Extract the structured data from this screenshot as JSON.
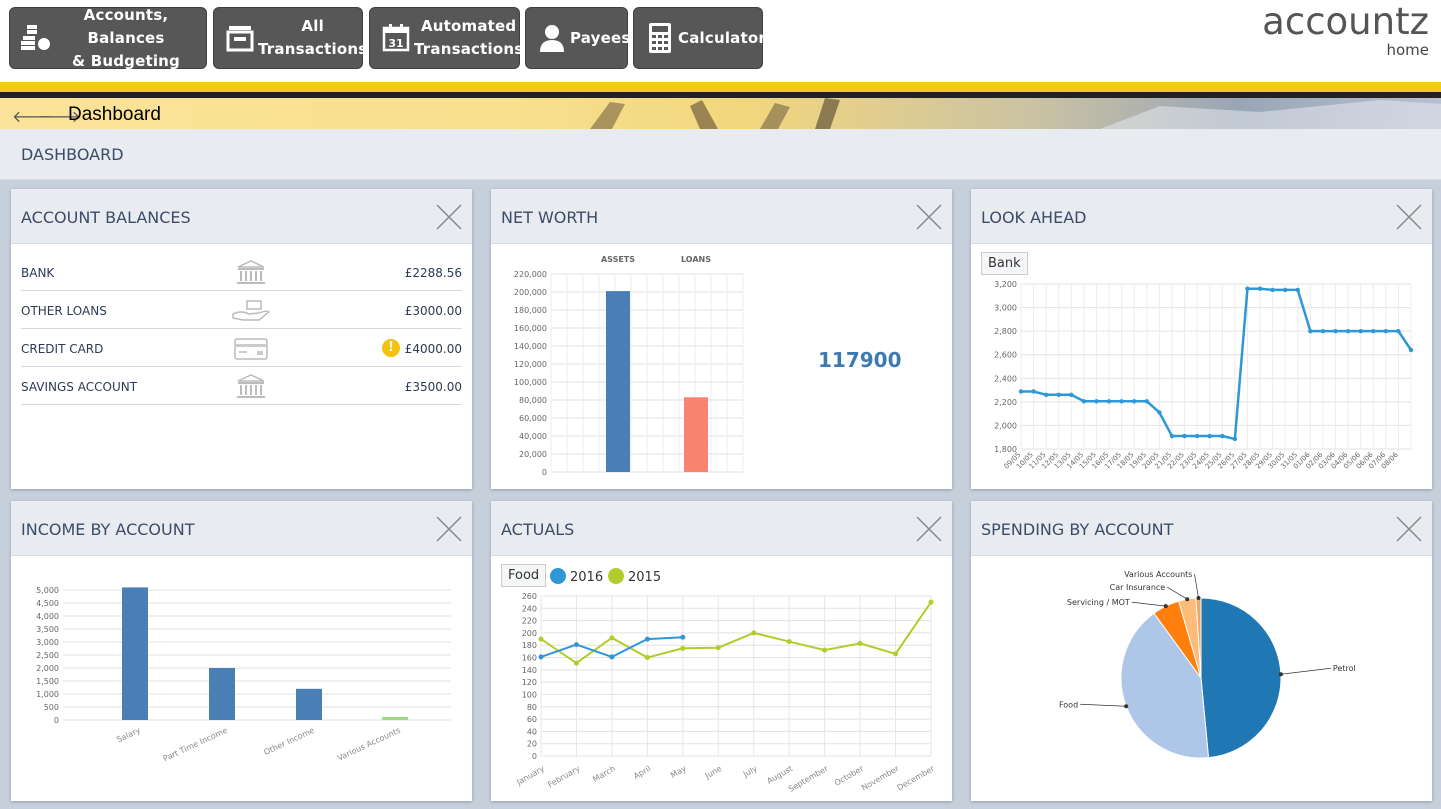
{
  "nav": {
    "buttons": [
      {
        "label": "Accounts, Balances\n& Budgeting",
        "icon": "coins-stack-icon"
      },
      {
        "label": "All\nTransactions",
        "icon": "inbox-tray-icon"
      },
      {
        "label": "Automated\nTransactions",
        "icon": "calendar-31-icon"
      },
      {
        "label": "Payees",
        "icon": "person-icon"
      },
      {
        "label": "Calculator",
        "icon": "calculator-icon"
      }
    ]
  },
  "logo": {
    "brand": "accountz",
    "sub": "home"
  },
  "breadcrumb": {
    "title": "Dashboard"
  },
  "header": {
    "title": "DASHBOARD"
  },
  "colors": {
    "accent_yellow": "#f2ca1a",
    "bar_blue": "#4a7fb5",
    "loans_salmon": "#f88370",
    "line_blue": "#2e98d6",
    "line_green": "#b2cc29"
  },
  "panels": {
    "account_balances": {
      "title": "ACCOUNT BALANCES",
      "rows": [
        {
          "name": "BANK",
          "icon": "bank-building-icon",
          "amount": "£2288.56",
          "warning": false
        },
        {
          "name": "OTHER LOANS",
          "icon": "hand-money-icon",
          "amount": "£3000.00",
          "warning": false
        },
        {
          "name": "CREDIT CARD",
          "icon": "credit-card-icon",
          "amount": "£4000.00",
          "warning": true
        },
        {
          "name": "SAVINGS ACCOUNT",
          "icon": "bank-building-icon",
          "amount": "£3500.00",
          "warning": false
        }
      ],
      "warning_glyph": "!"
    },
    "net_worth": {
      "title": "NET WORTH",
      "value": "117900"
    },
    "look_ahead": {
      "title": "LOOK AHEAD",
      "tag": "Bank"
    },
    "income_by_account": {
      "title": "INCOME BY ACCOUNT"
    },
    "actuals": {
      "title": "ACTUALS",
      "tag": "Food"
    },
    "spending_by_account": {
      "title": "SPENDING BY ACCOUNT"
    }
  },
  "chart_data": [
    {
      "id": "net_worth",
      "type": "bar",
      "categories": [
        "ASSETS",
        "LOANS"
      ],
      "values": [
        201000,
        83000
      ],
      "ylim": [
        0,
        220000
      ],
      "yticks": [
        "0",
        "20,000",
        "40,000",
        "60,000",
        "80,000",
        "100,000",
        "120,000",
        "140,000",
        "160,000",
        "180,000",
        "200,000",
        "220,000"
      ],
      "colors": [
        "#4a7fb5",
        "#f88370"
      ],
      "grid": true
    },
    {
      "id": "look_ahead",
      "type": "line",
      "x": [
        "09/05",
        "10/05",
        "11/05",
        "12/05",
        "13/05",
        "14/05",
        "15/05",
        "16/05",
        "17/05",
        "18/05",
        "19/05",
        "20/05",
        "21/05",
        "22/05",
        "23/05",
        "24/05",
        "25/05",
        "26/05",
        "27/05",
        "28/05",
        "29/05",
        "30/05",
        "31/05",
        "01/06",
        "02/06",
        "03/06",
        "04/06",
        "05/06",
        "06/06",
        "07/06",
        "08/06"
      ],
      "series": [
        {
          "values": [
            2288,
            2288,
            2260,
            2260,
            2260,
            2205,
            2205,
            2205,
            2205,
            2205,
            2205,
            2110,
            1910,
            1910,
            1910,
            1910,
            1910,
            1885,
            3160,
            3160,
            3150,
            3150,
            3150,
            2800,
            2800,
            2800,
            2800,
            2800,
            2800,
            2800,
            2800,
            2640
          ]
        }
      ],
      "ylim": [
        1800,
        3200
      ],
      "yticks": [
        "1,800",
        "2,000",
        "2,200",
        "2,400",
        "2,600",
        "2,800",
        "3,000",
        "3,200"
      ],
      "grid": true
    },
    {
      "id": "income_by_account",
      "type": "bar",
      "categories": [
        "Salary",
        "Part Time Income",
        "Other Income",
        "Various Accounts"
      ],
      "values": [
        5100,
        2000,
        1200,
        70
      ],
      "ylim": [
        0,
        5000
      ],
      "yticks": [
        "0",
        "500",
        "1,000",
        "1,500",
        "2,000",
        "2,500",
        "3,000",
        "3,500",
        "4,000",
        "4,500",
        "5,000"
      ],
      "colors": [
        "#4a7fb5",
        "#4a7fb5",
        "#4a7fb5",
        "#98dd80"
      ],
      "grid": true
    },
    {
      "id": "actuals",
      "type": "line",
      "categories": [
        "January",
        "February",
        "March",
        "April",
        "May",
        "June",
        "July",
        "August",
        "September",
        "October",
        "November",
        "December"
      ],
      "series": [
        {
          "name": "2016",
          "color": "#2e98d6",
          "values": [
            161,
            181,
            161,
            190,
            193
          ]
        },
        {
          "name": "2015",
          "color": "#b2cc29",
          "values": [
            190,
            151,
            192,
            160,
            175,
            176,
            200,
            186,
            172,
            183,
            166,
            250
          ]
        }
      ],
      "ylim": [
        0,
        260
      ],
      "yticks": [
        "0",
        "20",
        "40",
        "60",
        "80",
        "100",
        "120",
        "140",
        "160",
        "180",
        "200",
        "220",
        "240",
        "260"
      ],
      "grid": true
    },
    {
      "id": "spending_by_account",
      "type": "pie",
      "labels": [
        "Petrol",
        "Food",
        "Servicing / MOT",
        "Car Insurance",
        "Various Accounts"
      ],
      "values": [
        48.5,
        41.5,
        5.5,
        3.5,
        1.0
      ],
      "colors": [
        "#1f77b4",
        "#aec7e8",
        "#ff7f0e",
        "#ffbb78",
        "#f4a460"
      ]
    }
  ]
}
